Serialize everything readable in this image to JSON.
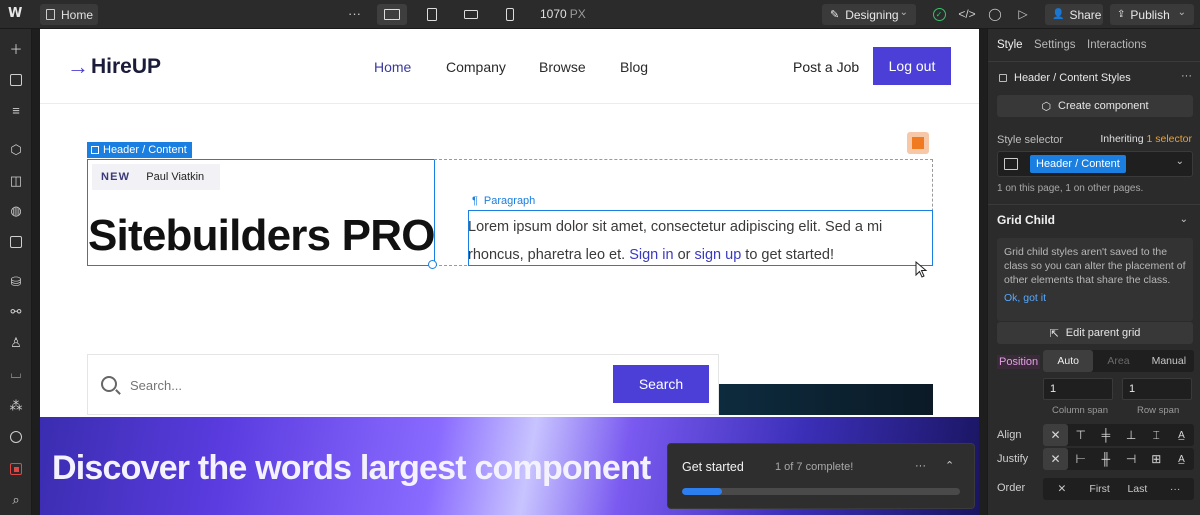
{
  "topbar": {
    "logo": "W",
    "page_name": "Home",
    "more": "···",
    "width_value": "1070",
    "width_unit": "PX",
    "mode_label": "Designing",
    "share_label": "Share",
    "publish_label": "Publish"
  },
  "site": {
    "logo_arrow": "→",
    "logo_text": "HireUP",
    "nav": [
      "Home",
      "Company",
      "Browse",
      "Blog"
    ],
    "post_job": "Post a Job",
    "logout": "Log out",
    "selection_label": "Header / Content",
    "badge_tag": "NEW",
    "badge_author": "Paul Viatkin",
    "hero_title": "Sitebuilders PRO",
    "paragraph_label": "Paragraph",
    "paragraph_line1": "Lorem ipsum dolor sit amet, consectetur adipiscing elit. Sed a mi",
    "paragraph_line2_a": "rhoncus, pharetra leo et. ",
    "paragraph_link1": "Sign in",
    "paragraph_or": " or ",
    "paragraph_link2": "sign up",
    "paragraph_end": " to get started!",
    "search_placeholder": "Search...",
    "search_button": "Search",
    "banner_text": "Discover the words largest component"
  },
  "get_started": {
    "title": "Get started",
    "progress_text": "1 of 7 complete!",
    "progress_fraction": 0.143,
    "more": "···",
    "collapse": "⌃"
  },
  "panel": {
    "tabs": [
      "Style",
      "Settings",
      "Interactions"
    ],
    "active_tab": "Style",
    "element_title": "Header / Content Styles",
    "more": "···",
    "create_component": "Create component",
    "style_selector_label": "Style selector",
    "inheriting_label": "Inheriting",
    "inheriting_count": "1 selector",
    "selector_chip": "Header / Content",
    "selector_note": "1 on this page, 1 on other pages.",
    "section_title": "Grid Child",
    "info_text": "Grid child styles aren't saved to the class so you can alter the placement of other elements that share the class.",
    "info_ok": "Ok, got it",
    "edit_parent_grid": "Edit parent grid",
    "position_label": "Position",
    "position_options": [
      "Auto",
      "Area",
      "Manual"
    ],
    "column_span_value": "1",
    "row_span_value": "1",
    "column_span_label": "Column span",
    "row_span_label": "Row span",
    "align_label": "Align",
    "justify_label": "Justify",
    "order_label": "Order",
    "order_options": [
      "✕",
      "First",
      "Last",
      "···"
    ]
  }
}
